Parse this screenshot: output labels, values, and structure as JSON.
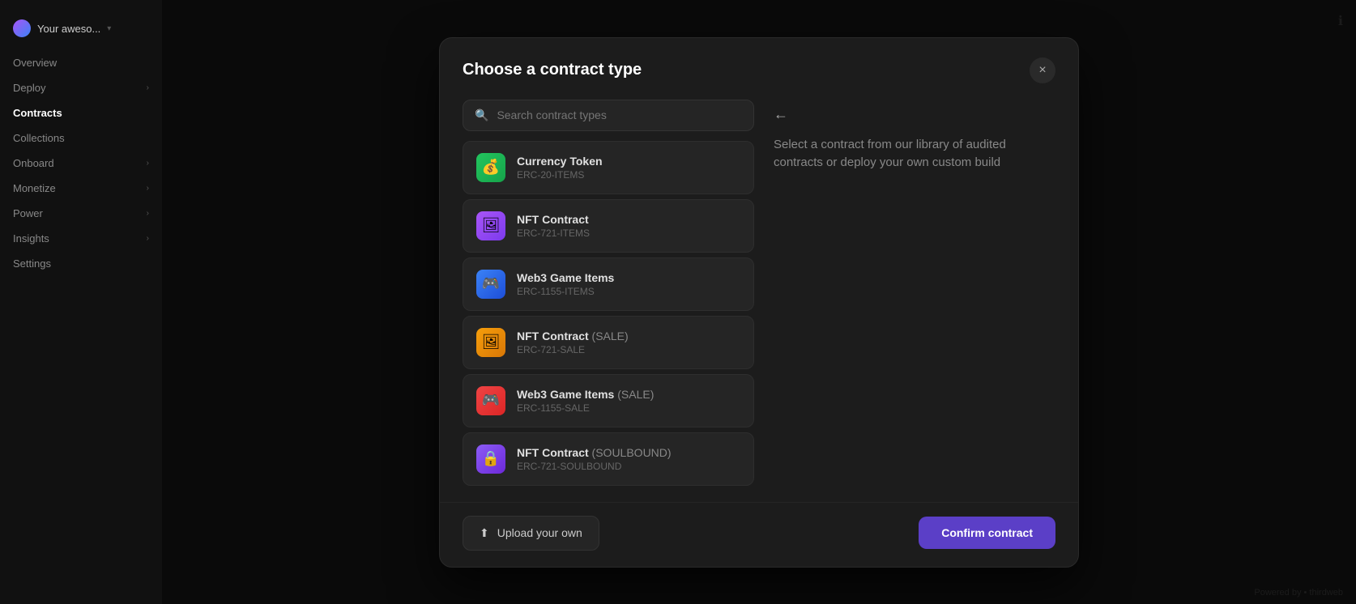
{
  "app": {
    "title": "Your aweso..."
  },
  "sidebar": {
    "items": [
      {
        "label": "Overview",
        "active": false,
        "hasChevron": false
      },
      {
        "label": "Deploy",
        "active": false,
        "hasChevron": true
      },
      {
        "label": "Contracts",
        "active": true,
        "hasChevron": false
      },
      {
        "label": "Collections",
        "active": false,
        "hasChevron": false
      },
      {
        "label": "Onboard",
        "active": false,
        "hasChevron": true
      },
      {
        "label": "Monetize",
        "active": false,
        "hasChevron": true
      },
      {
        "label": "Power",
        "active": false,
        "hasChevron": true
      },
      {
        "label": "Insights",
        "active": false,
        "hasChevron": true
      },
      {
        "label": "Settings",
        "active": false,
        "hasChevron": false
      }
    ]
  },
  "modal": {
    "title": "Choose a contract type",
    "close_label": "×",
    "right_hint": "Select a contract from our library of audited contracts or deploy your own custom build",
    "search": {
      "placeholder": "Search contract types"
    },
    "contracts": [
      {
        "name": "Currency Token",
        "tag": "",
        "type": "ERC-20-ITEMS",
        "icon_class": "icon-erc20",
        "icon": "💰"
      },
      {
        "name": "NFT Contract",
        "tag": "",
        "type": "ERC-721-ITEMS",
        "icon_class": "icon-erc721",
        "icon": "🖼"
      },
      {
        "name": "Web3 Game Items",
        "tag": "",
        "type": "ERC-1155-ITEMS",
        "icon_class": "icon-erc1155",
        "icon": "🎮"
      },
      {
        "name": "NFT Contract",
        "tag": "(SALE)",
        "type": "ERC-721-SALE",
        "icon_class": "icon-erc721sale",
        "icon": "🖼"
      },
      {
        "name": "Web3 Game Items",
        "tag": "(SALE)",
        "type": "ERC-1155-SALE",
        "icon_class": "icon-erc1155sale",
        "icon": "🎮"
      },
      {
        "name": "NFT Contract",
        "tag": "(SOULBOUND)",
        "type": "ERC-721-SOULBOUND",
        "icon_class": "icon-soulbound",
        "icon": "🔒"
      }
    ],
    "footer": {
      "upload_label": "Upload your own",
      "confirm_label": "Confirm contract"
    }
  },
  "bottom_hint": "Powered by • thirdweb"
}
